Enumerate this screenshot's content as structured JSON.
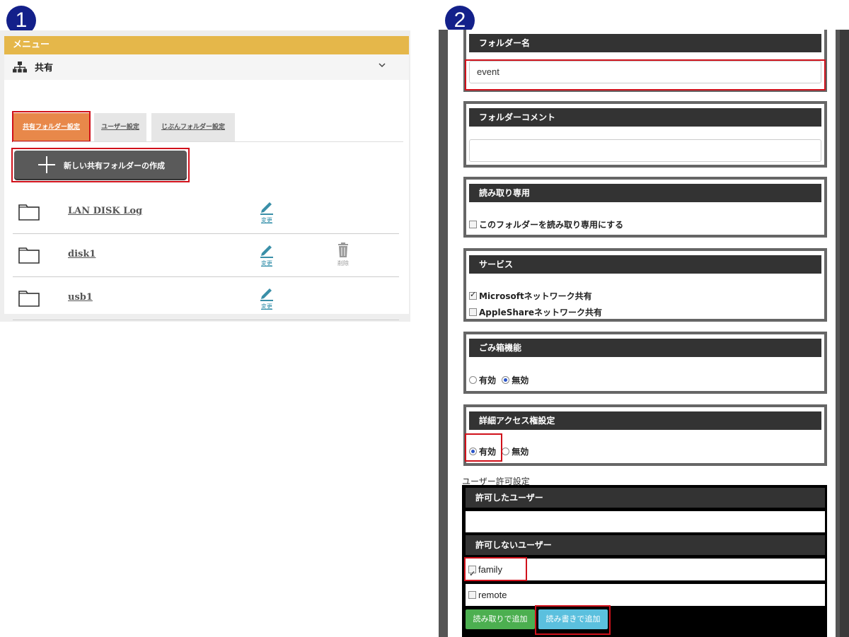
{
  "badges": {
    "step1": "1",
    "step2": "2"
  },
  "left": {
    "menu_label": "メニュー",
    "share_title": "共有",
    "tabs": [
      {
        "label": "共有フォルダー設定",
        "active": true
      },
      {
        "label": "ユーザー設定",
        "active": false
      },
      {
        "label": "じぶんフォルダー設定",
        "active": false
      }
    ],
    "create_button": "新しい共有フォルダーの作成",
    "folders": [
      {
        "name": "LAN DISK Log",
        "edit": "変更"
      },
      {
        "name": "disk1",
        "edit": "変更",
        "delete": "削除"
      },
      {
        "name": "usb1",
        "edit": "変更"
      }
    ]
  },
  "right": {
    "folder_name": {
      "heading": "フォルダー名",
      "value": "event"
    },
    "folder_comment": {
      "heading": "フォルダーコメント",
      "value": ""
    },
    "read_only": {
      "heading": "読み取り専用",
      "option": "このフォルダーを読み取り専用にする",
      "checked": false
    },
    "services": {
      "heading": "サービス",
      "options": [
        {
          "label": "Microsoftネットワーク共有",
          "checked": true
        },
        {
          "label": "AppleShareネットワーク共有",
          "checked": false
        }
      ]
    },
    "trash": {
      "heading": "ごみ箱機能",
      "enable": "有効",
      "disable": "無効",
      "selected": "無効"
    },
    "access": {
      "heading": "詳細アクセス権設定",
      "enable": "有効",
      "disable": "無効",
      "selected": "有効"
    },
    "permissions": {
      "label": "ユーザー許可設定",
      "allowed_heading": "許可したユーザー",
      "denied_heading": "許可しないユーザー",
      "users": [
        {
          "name": "family",
          "checked": true
        },
        {
          "name": "remote",
          "checked": false
        }
      ],
      "add_read_button": "読み取りで追加",
      "add_write_button": "読み書きで追加"
    }
  },
  "colors": {
    "menu_bar": "#e5b74a",
    "active_tab": "#e8884a",
    "highlight": "#d0111b",
    "badge": "#13208a",
    "green_button": "#4caf50",
    "blue_button": "#5bc0de"
  }
}
